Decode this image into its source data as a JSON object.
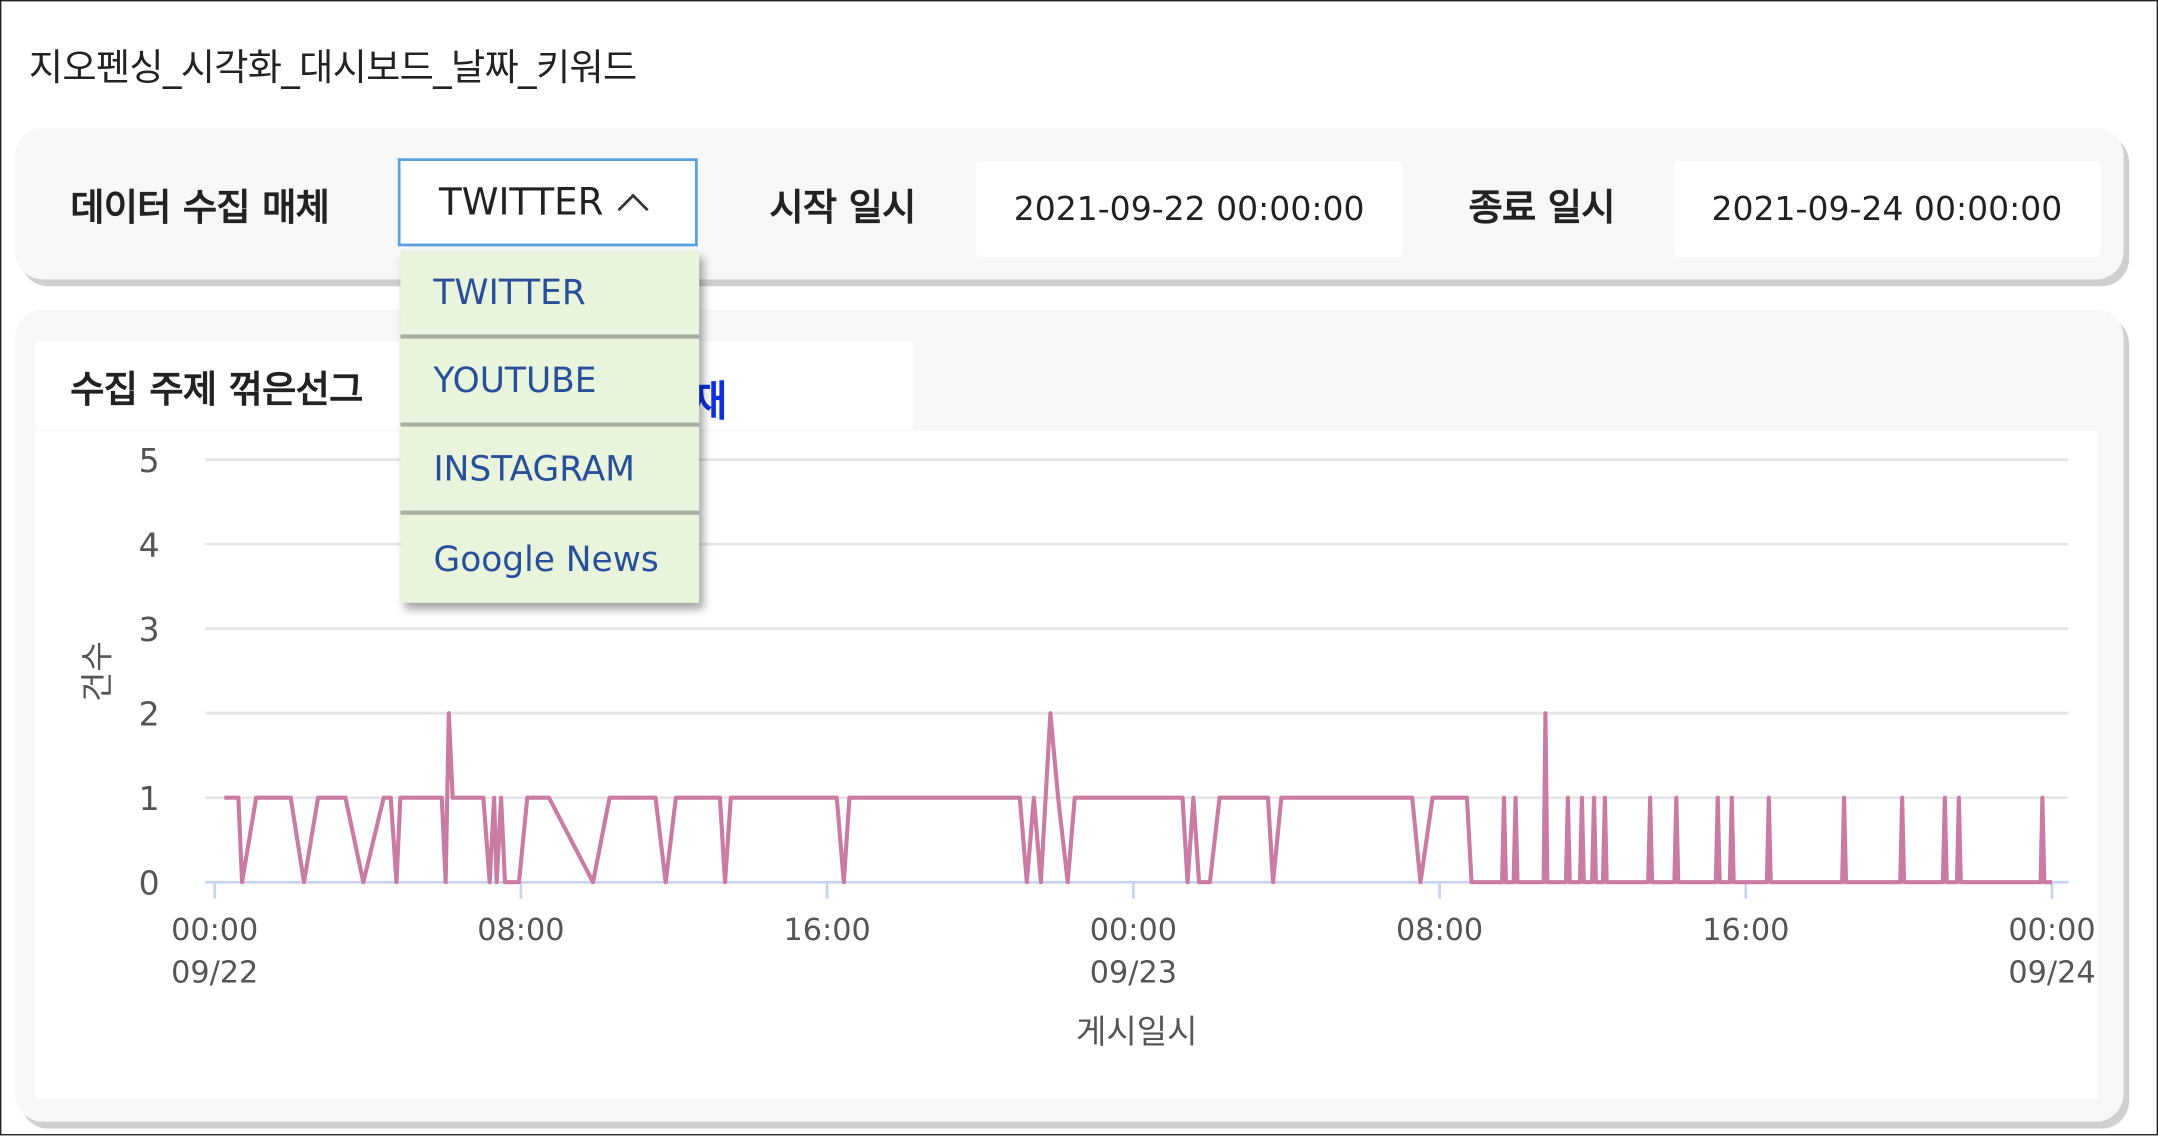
{
  "page_title": "지오펜싱_시각화_대시보드_날짜_키워드",
  "filters": {
    "media_label": "데이터 수집 매체",
    "media_selected": "TWITTER",
    "media_options": [
      "TWITTER",
      "YOUTUBE",
      "INSTAGRAM",
      "Google News"
    ],
    "start_label": "시작 일시",
    "start_value": "2021-09-22 00:00:00",
    "end_label": "종료 일시",
    "end_value": "2021-09-24 00:00:00"
  },
  "chart_header": {
    "title_visible": "수집 주제 꺾은선그",
    "keyword_visible": "재"
  },
  "chart_data": {
    "type": "line",
    "xlabel": "게시일시",
    "ylabel": "건수",
    "ylim": [
      0,
      5
    ],
    "yticks": [
      "0",
      "1",
      "2",
      "3",
      "4",
      "5"
    ],
    "xlim": [
      "2021-09-22 00:00",
      "2021-09-24 00:00"
    ],
    "xticks": [
      {
        "t": "2021-09-22 00:00",
        "label": "00:00",
        "sub": "09/22"
      },
      {
        "t": "2021-09-22 08:00",
        "label": "08:00",
        "sub": ""
      },
      {
        "t": "2021-09-22 16:00",
        "label": "16:00",
        "sub": ""
      },
      {
        "t": "2021-09-23 00:00",
        "label": "00:00",
        "sub": "09/23"
      },
      {
        "t": "2021-09-23 08:00",
        "label": "08:00",
        "sub": ""
      },
      {
        "t": "2021-09-23 16:00",
        "label": "16:00",
        "sub": ""
      },
      {
        "t": "2021-09-24 00:00",
        "label": "00:00",
        "sub": "09/24"
      }
    ],
    "grid": true,
    "color": "#c97ba3",
    "points": [
      [
        "2021-09-22 00:15",
        1
      ],
      [
        "2021-09-22 00:37",
        1
      ],
      [
        "2021-09-22 00:43",
        0
      ],
      [
        "2021-09-22 01:05",
        1
      ],
      [
        "2021-09-22 01:59",
        1
      ],
      [
        "2021-09-22 02:20",
        0
      ],
      [
        "2021-09-22 02:42",
        1
      ],
      [
        "2021-09-22 03:25",
        1
      ],
      [
        "2021-09-22 03:53",
        0
      ],
      [
        "2021-09-22 04:25",
        1
      ],
      [
        "2021-09-22 04:36",
        1
      ],
      [
        "2021-09-22 04:45",
        0
      ],
      [
        "2021-09-22 04:51",
        1
      ],
      [
        "2021-09-22 05:56",
        1
      ],
      [
        "2021-09-22 06:02",
        0
      ],
      [
        "2021-09-22 06:07",
        2
      ],
      [
        "2021-09-22 06:13",
        1
      ],
      [
        "2021-09-22 07:01",
        1
      ],
      [
        "2021-09-22 07:11",
        0
      ],
      [
        "2021-09-22 07:18",
        1
      ],
      [
        "2021-09-22 07:22",
        0
      ],
      [
        "2021-09-22 07:29",
        1
      ],
      [
        "2021-09-22 07:35",
        0
      ],
      [
        "2021-09-22 07:57",
        0
      ],
      [
        "2021-09-22 08:10",
        1
      ],
      [
        "2021-09-22 08:44",
        1
      ],
      [
        "2021-09-22 09:53",
        0
      ],
      [
        "2021-09-22 10:19",
        1
      ],
      [
        "2021-09-22 11:31",
        1
      ],
      [
        "2021-09-22 11:47",
        0
      ],
      [
        "2021-09-22 12:03",
        1
      ],
      [
        "2021-09-22 13:12",
        1
      ],
      [
        "2021-09-22 13:20",
        0
      ],
      [
        "2021-09-22 13:29",
        1
      ],
      [
        "2021-09-22 16:15",
        1
      ],
      [
        "2021-09-22 16:26",
        0
      ],
      [
        "2021-09-22 16:35",
        1
      ],
      [
        "2021-09-22 21:02",
        1
      ],
      [
        "2021-09-22 21:13",
        0
      ],
      [
        "2021-09-22 21:24",
        1
      ],
      [
        "2021-09-22 21:35",
        0
      ],
      [
        "2021-09-22 21:50",
        2
      ],
      [
        "2021-09-22 22:02",
        1
      ],
      [
        "2021-09-22 22:17",
        0
      ],
      [
        "2021-09-22 22:28",
        1
      ],
      [
        "2021-09-23 01:17",
        1
      ],
      [
        "2021-09-23 01:25",
        0
      ],
      [
        "2021-09-23 01:34",
        1
      ],
      [
        "2021-09-23 01:43",
        0
      ],
      [
        "2021-09-23 02:00",
        0
      ],
      [
        "2021-09-23 02:15",
        1
      ],
      [
        "2021-09-23 03:31",
        1
      ],
      [
        "2021-09-23 03:39",
        0
      ],
      [
        "2021-09-23 03:52",
        1
      ],
      [
        "2021-09-23 07:17",
        1
      ],
      [
        "2021-09-23 07:30",
        0
      ],
      [
        "2021-09-23 07:49",
        1
      ],
      [
        "2021-09-23 08:43",
        1
      ],
      [
        "2021-09-23 08:50",
        0
      ],
      [
        "2021-09-23 09:38",
        0
      ],
      [
        "2021-09-23 09:41",
        1
      ],
      [
        "2021-09-23 09:44",
        0
      ],
      [
        "2021-09-23 09:56",
        0
      ],
      [
        "2021-09-23 09:59",
        1
      ],
      [
        "2021-09-23 10:02",
        0
      ],
      [
        "2021-09-23 10:43",
        0
      ],
      [
        "2021-09-23 10:46",
        2
      ],
      [
        "2021-09-23 10:49",
        0
      ],
      [
        "2021-09-23 11:18",
        0
      ],
      [
        "2021-09-23 11:21",
        1
      ],
      [
        "2021-09-23 11:24",
        0
      ],
      [
        "2021-09-23 11:40",
        0
      ],
      [
        "2021-09-23 11:43",
        1
      ],
      [
        "2021-09-23 11:46",
        0
      ],
      [
        "2021-09-23 11:59",
        0
      ],
      [
        "2021-09-23 12:02",
        1
      ],
      [
        "2021-09-23 12:05",
        0
      ],
      [
        "2021-09-23 12:16",
        0
      ],
      [
        "2021-09-23 12:19",
        1
      ],
      [
        "2021-09-23 12:22",
        0
      ],
      [
        "2021-09-23 13:27",
        0
      ],
      [
        "2021-09-23 13:30",
        1
      ],
      [
        "2021-09-23 13:33",
        0
      ],
      [
        "2021-09-23 14:08",
        0
      ],
      [
        "2021-09-23 14:11",
        1
      ],
      [
        "2021-09-23 14:14",
        0
      ],
      [
        "2021-09-23 15:13",
        0
      ],
      [
        "2021-09-23 15:16",
        1
      ],
      [
        "2021-09-23 15:19",
        0
      ],
      [
        "2021-09-23 15:35",
        0
      ],
      [
        "2021-09-23 15:38",
        1
      ],
      [
        "2021-09-23 15:41",
        0
      ],
      [
        "2021-09-23 16:33",
        0
      ],
      [
        "2021-09-23 16:36",
        1
      ],
      [
        "2021-09-23 16:39",
        0
      ],
      [
        "2021-09-23 18:31",
        0
      ],
      [
        "2021-09-23 18:34",
        1
      ],
      [
        "2021-09-23 18:37",
        0
      ],
      [
        "2021-09-23 20:02",
        0
      ],
      [
        "2021-09-23 20:05",
        1
      ],
      [
        "2021-09-23 20:08",
        0
      ],
      [
        "2021-09-23 21:09",
        0
      ],
      [
        "2021-09-23 21:12",
        1
      ],
      [
        "2021-09-23 21:15",
        0
      ],
      [
        "2021-09-23 21:31",
        0
      ],
      [
        "2021-09-23 21:34",
        1
      ],
      [
        "2021-09-23 21:37",
        0
      ],
      [
        "2021-09-23 23:42",
        0
      ],
      [
        "2021-09-23 23:45",
        1
      ],
      [
        "2021-09-23 23:48",
        0
      ],
      [
        "2021-09-24 00:00",
        0
      ]
    ]
  }
}
